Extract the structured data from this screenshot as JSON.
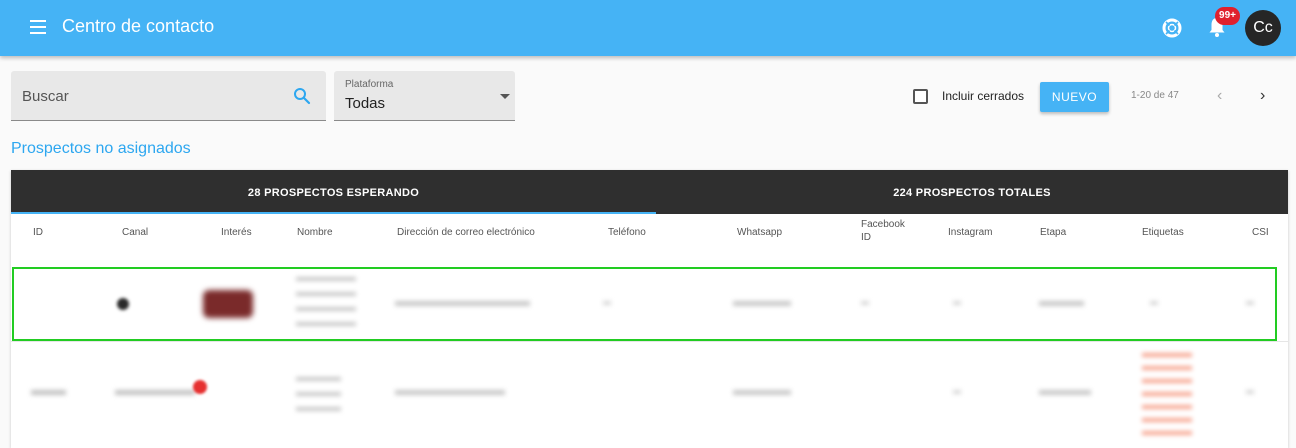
{
  "app": {
    "title": "Centro de contacto",
    "notifications_badge": "99+",
    "avatar_initials": "Cc"
  },
  "filters": {
    "search_placeholder": "Buscar",
    "platform_label": "Plataforma",
    "platform_value": "Todas",
    "include_closed_label": "Incluir cerrados",
    "include_closed_checked": false,
    "new_button": "NUEVO",
    "pagination": "1-20 de 47"
  },
  "section": {
    "title": "Prospectos no asignados"
  },
  "tabs": [
    {
      "label": "28 PROSPECTOS ESPERANDO",
      "active": true
    },
    {
      "label": "224 PROSPECTOS TOTALES",
      "active": false
    }
  ],
  "table": {
    "columns": [
      "ID",
      "Canal",
      "Interés",
      "Nombre",
      "Dirección de correo electrónico",
      "Teléfono",
      "Whatsapp",
      "Facebook ID",
      "Instagram",
      "Etapa",
      "Etiquetas",
      "CSI"
    ]
  },
  "icons": {
    "menu": "menu-icon",
    "help": "help-circle-icon",
    "notifications": "bell-icon",
    "search": "search-icon",
    "dropdown": "chevron-down-icon",
    "prev": "chevron-left-icon",
    "next": "chevron-right-icon"
  },
  "colors": {
    "appbar": "#45b3f5",
    "accent": "#2da7f0",
    "tabs_background": "#2f2f2f",
    "badge": "#e0202d",
    "tags_text": "#f06a4c",
    "highlight": "#22cc22"
  }
}
